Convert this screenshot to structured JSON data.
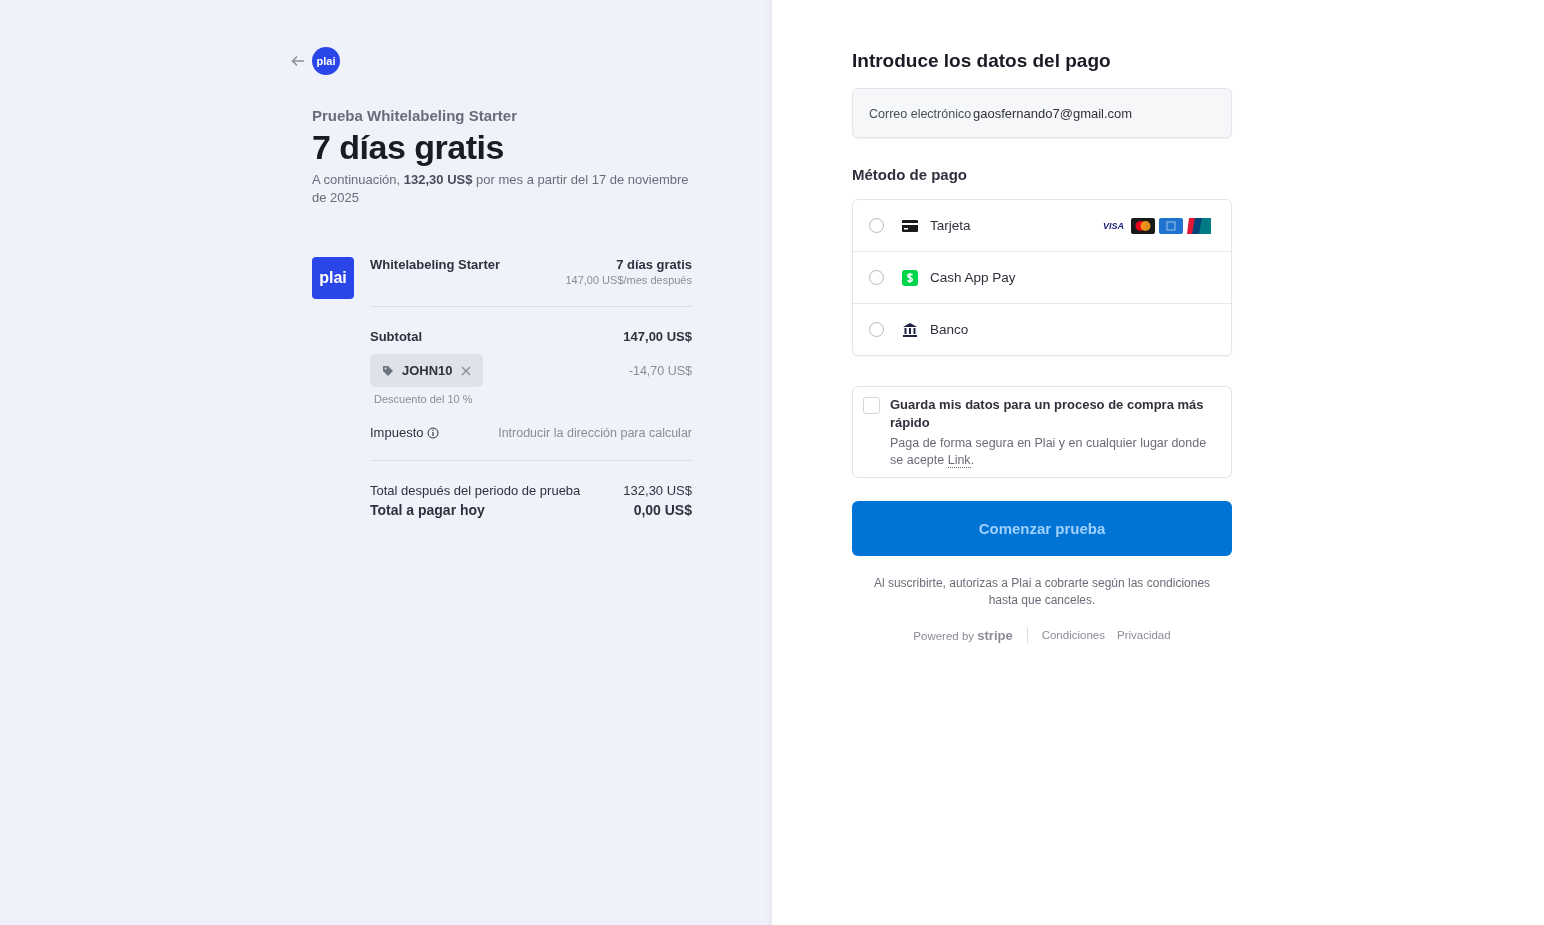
{
  "header": {
    "logo_text": "plai"
  },
  "summary": {
    "eyebrow": "Prueba Whitelabeling Starter",
    "title": "7 días gratis",
    "subtitle": "A continuación, **132,30 US$** por mes a partir del 17 de noviembre de 2025"
  },
  "product": {
    "logo_text": "plai",
    "name": "Whitelabeling Starter",
    "price": "7 días gratis",
    "note": "147,00 US$/mes después"
  },
  "subtotal": {
    "label": "Subtotal",
    "value": "147,00 US$"
  },
  "coupon": {
    "code": "JOHN10",
    "amount": "-14,70 US$",
    "note": "Descuento del 10 %"
  },
  "tax": {
    "label": "Impuesto",
    "value": "Introducir la dirección para calcular"
  },
  "totals": [
    {
      "label": "Total después del periodo de prueba",
      "value": "132,30 US$",
      "emphasis": false
    },
    {
      "label": "Total a pagar hoy",
      "value": "0,00 US$",
      "emphasis": true
    }
  ],
  "payment": {
    "title": "Introduce los datos del pago",
    "email": {
      "label": "Correo electrónico",
      "value": "gaosfernando7@gmail.com"
    },
    "method_title": "Método de pago",
    "methods": [
      {
        "kind": "card",
        "label": "Tarjeta",
        "selected": false,
        "brands": [
          "VISA"
        ]
      },
      {
        "kind": "cashapp",
        "label": "Cash App Pay",
        "selected": false
      },
      {
        "kind": "bank",
        "label": "Banco",
        "selected": false
      }
    ],
    "save": {
      "checked": false,
      "title": "Guarda mis datos para un proceso de compra más rápido",
      "text": "Paga de forma segura en Plai y en cualquier lugar donde se acepte ",
      "link": "Link",
      "text_end": "."
    },
    "button": "Comenzar prueba",
    "legal": "Al suscribirte, autorizas a Plai a cobrarte según las condiciones hasta que canceles.",
    "footer": {
      "powered": "Powered by **stripe**",
      "links": [
        "Condiciones",
        "Privacidad"
      ]
    }
  }
}
